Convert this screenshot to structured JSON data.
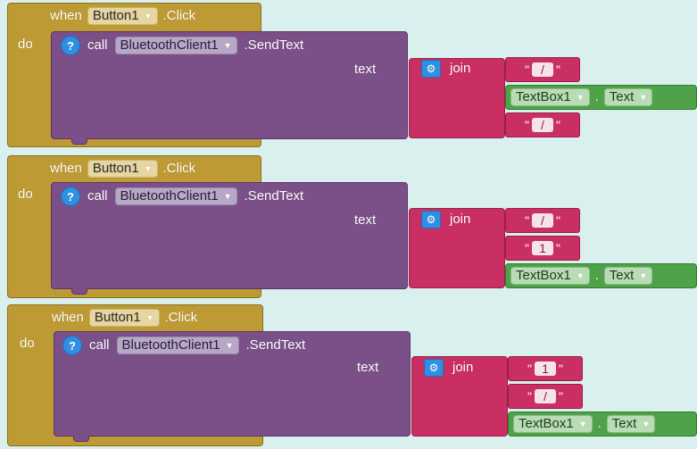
{
  "blocks": [
    {
      "event_when": "when",
      "component": "Button1",
      "event_name": ".Click",
      "do_label": "do",
      "help_glyph": "?",
      "call_label": "call",
      "target": "BluetoothClient1",
      "method": ".SendText",
      "arg_label": "text",
      "join_label": "join",
      "join_items": [
        {
          "type": "string",
          "value": "/"
        },
        {
          "type": "property",
          "component": "TextBox1",
          "dot": ".",
          "property": "Text"
        },
        {
          "type": "string",
          "value": "/"
        }
      ]
    },
    {
      "event_when": "when",
      "component": "Button1",
      "event_name": ".Click",
      "do_label": "do",
      "help_glyph": "?",
      "call_label": "call",
      "target": "BluetoothClient1",
      "method": ".SendText",
      "arg_label": "text",
      "join_label": "join",
      "join_items": [
        {
          "type": "string",
          "value": "/"
        },
        {
          "type": "string",
          "value": "1"
        },
        {
          "type": "property",
          "component": "TextBox1",
          "dot": ".",
          "property": "Text"
        }
      ]
    },
    {
      "event_when": "when",
      "component": "Button1",
      "event_name": ".Click",
      "do_label": "do",
      "help_glyph": "?",
      "call_label": "call",
      "target": "BluetoothClient1",
      "method": ".SendText",
      "arg_label": "text",
      "join_label": "join",
      "join_items": [
        {
          "type": "string",
          "value": "1"
        },
        {
          "type": "string",
          "value": "/"
        },
        {
          "type": "property",
          "component": "TextBox1",
          "dot": ".",
          "property": "Text"
        }
      ]
    }
  ],
  "icons": {
    "help": "help-question-icon",
    "mutator": "gear-mutator-icon",
    "dropdown": "chevron-down-icon"
  },
  "colors": {
    "background": "#d9f0ef",
    "event": "#bd9a34",
    "procedure_call": "#7b5089",
    "text_join": "#c92f62",
    "component_property": "#4fa24a"
  }
}
